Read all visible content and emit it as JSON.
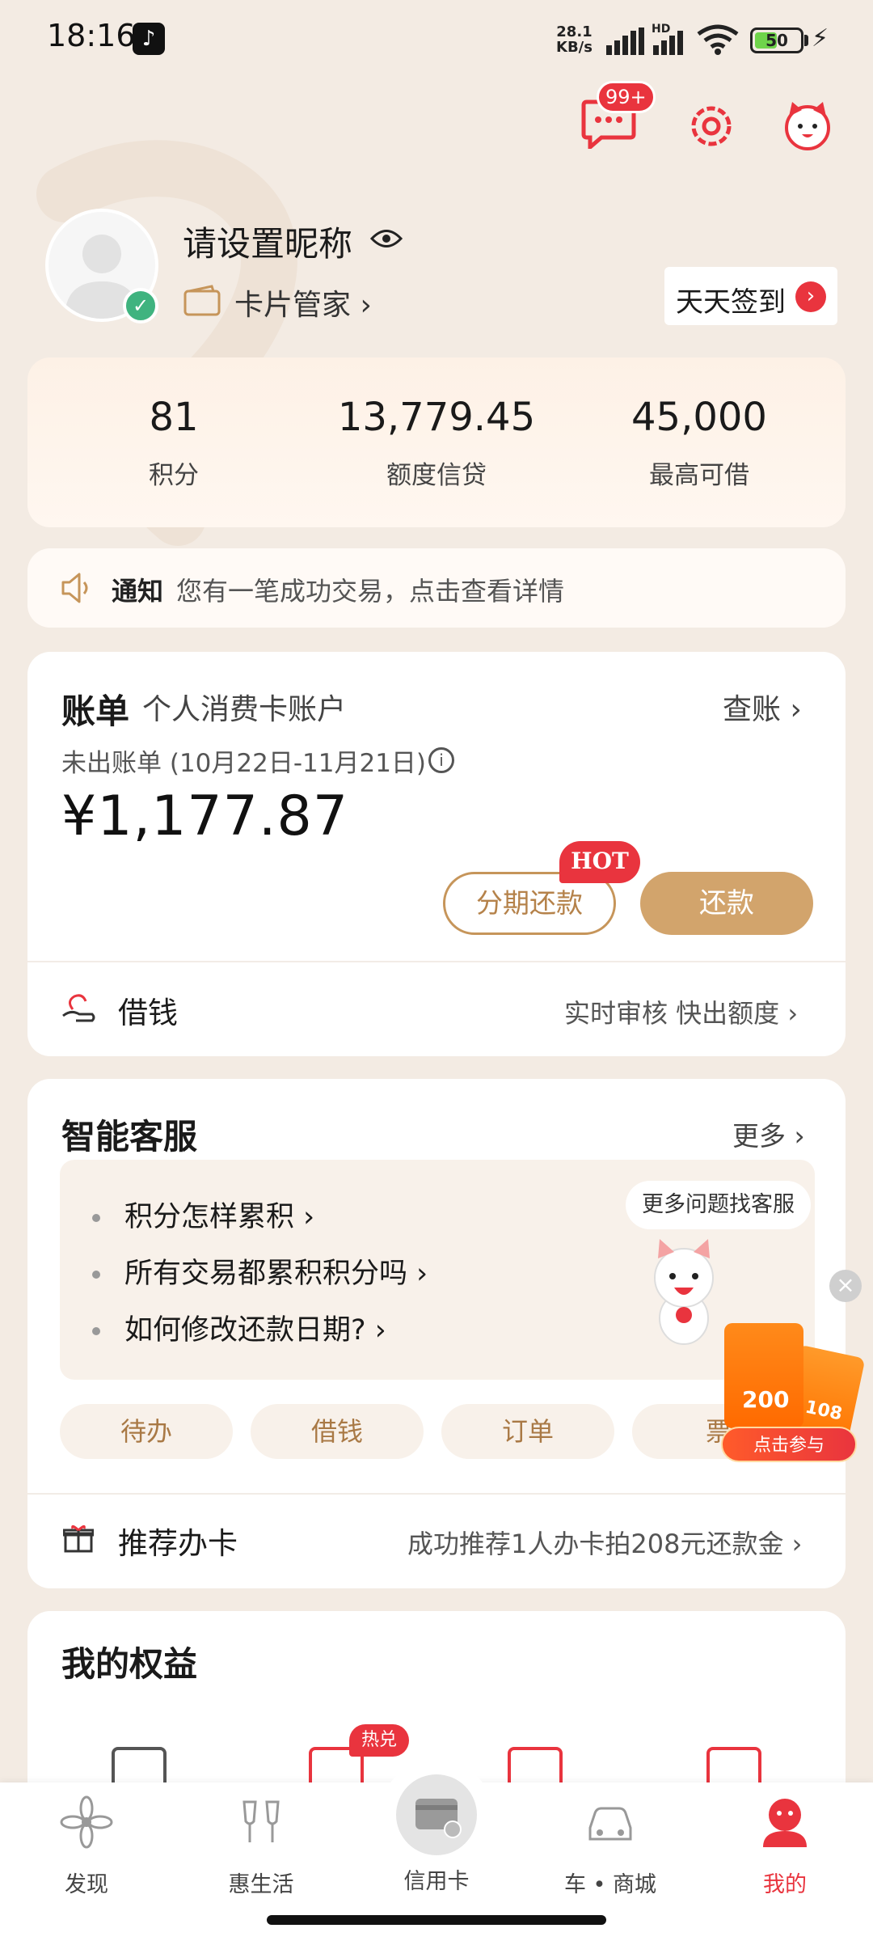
{
  "status_bar": {
    "time": "18:16",
    "net_speed_value": "28.1",
    "net_speed_unit": "KB/s",
    "hd_tag": "HD",
    "battery": "50",
    "battery_level": 0.5
  },
  "header": {
    "message_badge": "99+"
  },
  "profile": {
    "nickname": "请设置昵称",
    "card_manager": "卡片管家 ›",
    "checkin_label": "天天签到",
    "checkin_arrow": "›"
  },
  "stats": [
    {
      "value": "81",
      "label": "积分"
    },
    {
      "value": "13,779.45",
      "label": "额度信贷"
    },
    {
      "value": "45,000",
      "label": "最高可借"
    }
  ],
  "notice": {
    "label": "通知",
    "text": "您有一笔成功交易，点击查看详情"
  },
  "bill": {
    "title": "账单",
    "account": "个人消费卡账户",
    "check_link": "查账 ›",
    "unbilled": "未出账单 (10月22日-11月21日)",
    "info": "i",
    "amount": "¥1,177.87",
    "hot": "HOT",
    "installment": "分期还款",
    "repay": "还款",
    "borrow_label": "借钱",
    "borrow_sub": "实时审核 快出额度 ›"
  },
  "service": {
    "title": "智能客服",
    "more": "更多 ›",
    "faq": [
      "积分怎样累积 ›",
      "所有交易都累积积分吗 ›",
      "如何修改还款日期? ›"
    ],
    "bubble": "更多问题找客服",
    "pills": [
      "待办",
      "借钱",
      "订单",
      "票"
    ],
    "recommend": "推荐办卡",
    "recommend_sub": "成功推荐1人办卡拍208元还款金 ›"
  },
  "promo": {
    "close": "×",
    "amount1": "200",
    "amount2": "108",
    "button": "点击参与"
  },
  "rights": {
    "title": "我的权益",
    "hot_badge": "热兑"
  },
  "bottom_nav": [
    {
      "label": "发现",
      "icon": "flower-icon"
    },
    {
      "label": "惠生活",
      "icon": "cheers-icon"
    },
    {
      "label": "信用卡",
      "icon": "credit-card-icon"
    },
    {
      "label": "车 • 商城",
      "icon": "car-icon"
    },
    {
      "label": "我的",
      "icon": "profile-icon",
      "active": true
    }
  ],
  "colors": {
    "accent_red": "#e9343e",
    "gold": "#d2a46c",
    "background": "#f3ebe3"
  }
}
